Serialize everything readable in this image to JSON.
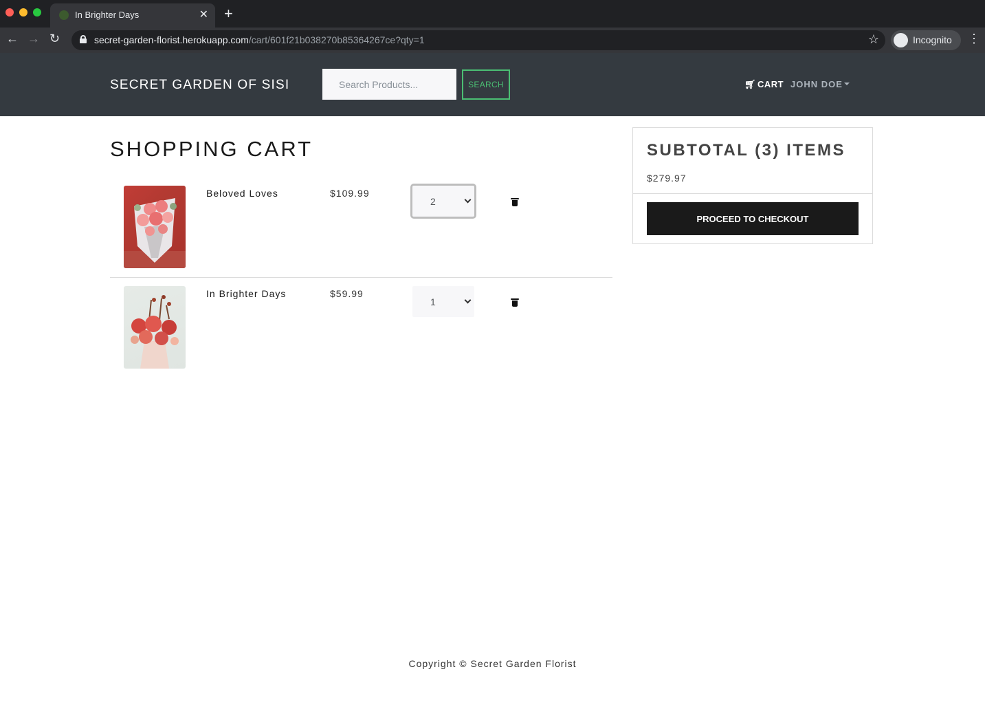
{
  "browser": {
    "tab_title": "In Brighter Days",
    "url_host": "secret-garden-florist.herokuapp.com",
    "url_path": "/cart/601f21b038270b85364267ce?qty=1",
    "profile_label": "Incognito"
  },
  "navbar": {
    "brand": "SECRET GARDEN OF SISI",
    "search_placeholder": "Search Products...",
    "search_button": "SEARCH",
    "cart_label": "CART",
    "user_label": "JOHN DOE"
  },
  "cart": {
    "title": "SHOPPING CART",
    "items": [
      {
        "name": "Beloved Loves",
        "price": "$109.99",
        "qty": "2"
      },
      {
        "name": "In Brighter Days",
        "price": "$59.99",
        "qty": "1"
      }
    ]
  },
  "summary": {
    "title": "SUBTOTAL (3) ITEMS",
    "amount": "$279.97",
    "checkout_button": "PROCEED TO CHECKOUT"
  },
  "footer": {
    "copyright": "Copyright © Secret Garden Florist"
  },
  "colors": {
    "navbar_bg": "#343a40",
    "accent_green": "#4bbf73",
    "checkout_bg": "#1a1a1a"
  }
}
